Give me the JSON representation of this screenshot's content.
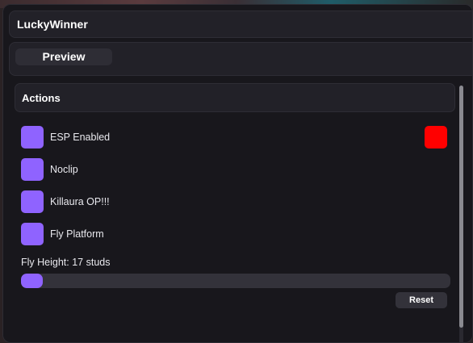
{
  "window": {
    "title": "LuckyWinner"
  },
  "tabs": [
    {
      "label": "Preview"
    }
  ],
  "section": {
    "title": "Actions"
  },
  "toggles": [
    {
      "label": "ESP Enabled",
      "enabled": true
    },
    {
      "label": "Noclip",
      "enabled": true
    },
    {
      "label": "Killaura OP!!!",
      "enabled": true
    },
    {
      "label": "Fly Platform",
      "enabled": true
    }
  ],
  "esp_color": "#ff0000",
  "accent_color": "#8f63ff",
  "slider": {
    "label": "Fly Height: 17 studs",
    "fraction": 0.05
  },
  "reset_label": "Reset"
}
